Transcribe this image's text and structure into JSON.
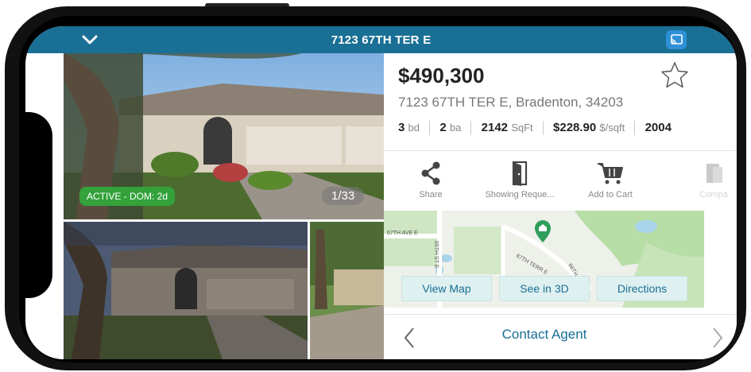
{
  "header": {
    "title": "7123 67TH TER E"
  },
  "photos": {
    "status_badge": "ACTIVE - DOM: 2d",
    "counter": "1/33"
  },
  "listing": {
    "price": "$490,300",
    "address": "7123 67TH TER E, Bradenton, 34203",
    "beds": "3",
    "beds_unit": "bd",
    "baths": "2",
    "baths_unit": "ba",
    "sqft": "2142",
    "sqft_unit": "SqFt",
    "price_per_sqft": "$228.90",
    "price_per_sqft_unit": "$/sqft",
    "year": "2004"
  },
  "actions": [
    {
      "label": "Share",
      "icon": "share-icon"
    },
    {
      "label": "Showing Reque...",
      "icon": "door-icon"
    },
    {
      "label": "Add to Cart",
      "icon": "cart-icon"
    },
    {
      "label": "Compa",
      "icon": "compare-icon"
    }
  ],
  "map": {
    "street_labels": [
      "67TH AVE E",
      "65TH ST E",
      "67TH TERR E",
      "66TH ST"
    ],
    "buttons": {
      "view_map": "View Map",
      "see_3d": "See in 3D",
      "directions": "Directions"
    }
  },
  "footer": {
    "contact": "Contact Agent"
  },
  "colors": {
    "header": "#1a6f95",
    "accent": "#1a6f95",
    "badge": "#33a23b",
    "pin": "#2e9e5b"
  }
}
